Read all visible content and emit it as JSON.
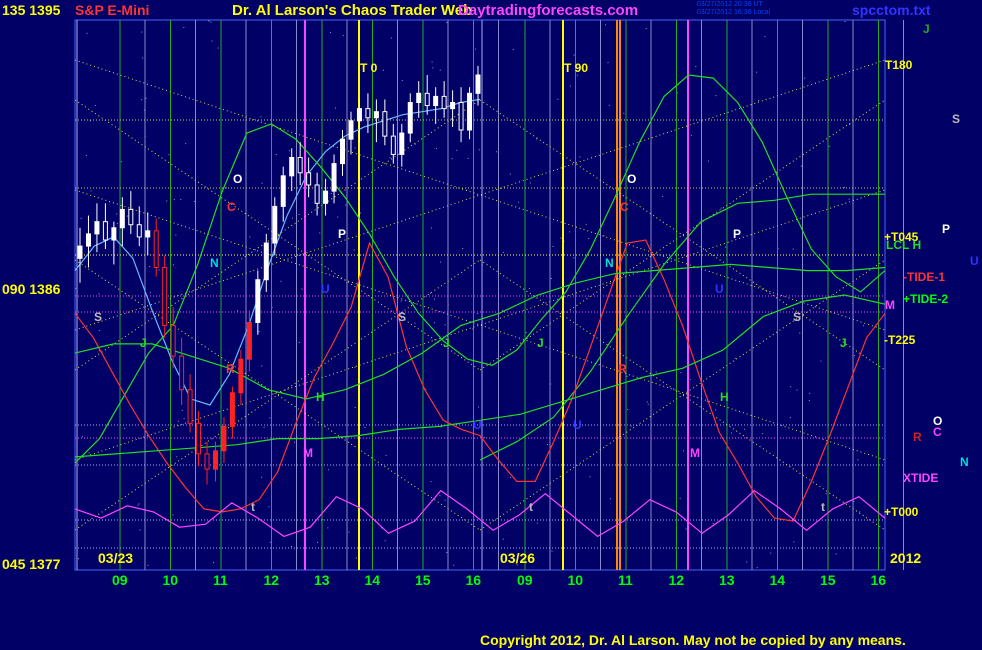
{
  "header": {
    "left_top": "135 1395",
    "instrument": "S&P E-Mini",
    "title": "Dr. Al Larson's Chaos Trader Web",
    "site": "Daytradingforecasts.com",
    "timestamp_1": "03/27/2012 20:36 UT",
    "timestamp_2": "03/27/2012 16:36 Local",
    "file": "spcctom.txt"
  },
  "axis": {
    "left_mid": "090 1386",
    "left_bottom": "045 1377",
    "date_left": "03/23",
    "date_right": "03/26",
    "year": "2012",
    "hours": [
      "09",
      "10",
      "11",
      "12",
      "13",
      "14",
      "15",
      "16",
      "09",
      "10",
      "11",
      "12",
      "13",
      "14",
      "15",
      "16"
    ]
  },
  "right_labels": {
    "j": "J",
    "t180": "T180",
    "s": "S",
    "p": "P",
    "t045": "+T045",
    "lcl_h": "LCL H",
    "tide1": "-TIDE-1",
    "tide2": "+TIDE-2",
    "m": "M",
    "t225": "-T225",
    "o": "O",
    "r": "R",
    "c": "C",
    "n": "N",
    "xtide": "XTIDE",
    "t000": "+T000",
    "u": "U"
  },
  "plot_markers": {
    "t0": "T 0",
    "t90": "T 90",
    "o": "O",
    "c": "C",
    "p": "P",
    "n": "N",
    "u": "U",
    "s": "S",
    "j": "J",
    "h": "H",
    "m": "M",
    "r": "R",
    "t": "t"
  },
  "copyright": "Copyright 2012, Dr. Al Larson. May not be copied by any means.",
  "colors": {
    "background": "#000066",
    "price_text": "#ffff00",
    "instrument": "#ff3333",
    "site": "#ff44ff",
    "file": "#3333ff",
    "hour_labels": "#00ff00",
    "tide1": "#ff3333",
    "tide2": "#00ff00",
    "xtide": "#ff44ff"
  },
  "chart_data": {
    "type": "line",
    "ylim": [
      1377,
      1395
    ],
    "y_ticks": [
      1377,
      1386,
      1395
    ],
    "sessions": [
      "03/23",
      "03/26"
    ],
    "price_bars": [
      {
        "o": 1387.2,
        "h": 1388.2,
        "l": 1386.4,
        "c": 1387.6
      },
      {
        "o": 1387.6,
        "h": 1388.6,
        "l": 1386.9,
        "c": 1388.0
      },
      {
        "o": 1388.0,
        "h": 1389.0,
        "l": 1387.4,
        "c": 1388.4
      },
      {
        "o": 1388.4,
        "h": 1389.0,
        "l": 1387.5,
        "c": 1387.8
      },
      {
        "o": 1387.8,
        "h": 1388.4,
        "l": 1387.0,
        "c": 1388.2
      },
      {
        "o": 1388.2,
        "h": 1389.2,
        "l": 1387.6,
        "c": 1388.8
      },
      {
        "o": 1388.8,
        "h": 1389.4,
        "l": 1388.0,
        "c": 1388.3
      },
      {
        "o": 1388.3,
        "h": 1388.9,
        "l": 1387.6,
        "c": 1387.9
      },
      {
        "o": 1387.9,
        "h": 1388.7,
        "l": 1387.3,
        "c": 1388.1
      },
      {
        "o": 1388.1,
        "h": 1388.5,
        "l": 1386.6,
        "c": 1386.9
      },
      {
        "o": 1386.9,
        "h": 1387.3,
        "l": 1384.6,
        "c": 1385.0
      },
      {
        "o": 1385.0,
        "h": 1385.6,
        "l": 1383.6,
        "c": 1384.0
      },
      {
        "o": 1384.0,
        "h": 1384.6,
        "l": 1382.4,
        "c": 1382.9
      },
      {
        "o": 1382.9,
        "h": 1383.4,
        "l": 1381.5,
        "c": 1381.8
      },
      {
        "o": 1381.8,
        "h": 1382.2,
        "l": 1380.4,
        "c": 1380.8
      },
      {
        "o": 1380.8,
        "h": 1381.2,
        "l": 1379.8,
        "c": 1380.3
      },
      {
        "o": 1380.3,
        "h": 1381.2,
        "l": 1379.9,
        "c": 1380.9
      },
      {
        "o": 1380.9,
        "h": 1382.0,
        "l": 1380.5,
        "c": 1381.7
      },
      {
        "o": 1381.7,
        "h": 1383.0,
        "l": 1381.3,
        "c": 1382.8
      },
      {
        "o": 1382.8,
        "h": 1384.2,
        "l": 1382.4,
        "c": 1383.9
      },
      {
        "o": 1383.9,
        "h": 1385.5,
        "l": 1383.5,
        "c": 1385.1
      },
      {
        "o": 1385.1,
        "h": 1386.8,
        "l": 1384.7,
        "c": 1386.5
      },
      {
        "o": 1386.5,
        "h": 1388.0,
        "l": 1386.1,
        "c": 1387.7
      },
      {
        "o": 1387.7,
        "h": 1389.2,
        "l": 1387.3,
        "c": 1388.9
      },
      {
        "o": 1388.9,
        "h": 1390.2,
        "l": 1388.4,
        "c": 1389.9
      },
      {
        "o": 1389.9,
        "h": 1390.8,
        "l": 1389.4,
        "c": 1390.5
      },
      {
        "o": 1390.5,
        "h": 1391.0,
        "l": 1389.6,
        "c": 1390.0
      },
      {
        "o": 1390.0,
        "h": 1390.5,
        "l": 1389.2,
        "c": 1389.6
      },
      {
        "o": 1389.6,
        "h": 1390.0,
        "l": 1388.6,
        "c": 1389.0
      },
      {
        "o": 1389.0,
        "h": 1389.8,
        "l": 1388.6,
        "c": 1389.4
      },
      {
        "o": 1389.4,
        "h": 1390.6,
        "l": 1389.0,
        "c": 1390.3
      },
      {
        "o": 1390.3,
        "h": 1391.4,
        "l": 1389.9,
        "c": 1391.1
      },
      {
        "o": 1391.1,
        "h": 1392.0,
        "l": 1390.6,
        "c": 1391.7
      },
      {
        "o": 1391.7,
        "h": 1392.4,
        "l": 1391.0,
        "c": 1392.1
      },
      {
        "o": 1392.1,
        "h": 1392.6,
        "l": 1391.3,
        "c": 1391.8
      },
      {
        "o": 1391.8,
        "h": 1392.4,
        "l": 1391.0,
        "c": 1392.0
      },
      {
        "o": 1392.0,
        "h": 1392.4,
        "l": 1390.9,
        "c": 1391.2
      },
      {
        "o": 1391.2,
        "h": 1391.6,
        "l": 1390.3,
        "c": 1390.6
      },
      {
        "o": 1390.6,
        "h": 1391.6,
        "l": 1390.2,
        "c": 1391.3
      },
      {
        "o": 1391.3,
        "h": 1392.6,
        "l": 1391.0,
        "c": 1392.3
      },
      {
        "o": 1392.3,
        "h": 1393.0,
        "l": 1391.8,
        "c": 1392.6
      },
      {
        "o": 1392.6,
        "h": 1393.2,
        "l": 1391.9,
        "c": 1392.2
      },
      {
        "o": 1392.2,
        "h": 1392.8,
        "l": 1391.6,
        "c": 1392.5
      },
      {
        "o": 1392.5,
        "h": 1393.0,
        "l": 1391.8,
        "c": 1392.1
      },
      {
        "o": 1392.1,
        "h": 1392.7,
        "l": 1391.5,
        "c": 1392.3
      },
      {
        "o": 1392.3,
        "h": 1392.8,
        "l": 1391.0,
        "c": 1391.4
      },
      {
        "o": 1391.4,
        "h": 1392.8,
        "l": 1391.1,
        "c": 1392.6
      },
      {
        "o": 1392.6,
        "h": 1393.5,
        "l": 1392.2,
        "c": 1393.2
      }
    ],
    "series": [
      {
        "values": [
          1386.8,
          1387.6,
          1387.9,
          1387.2,
          1385.5,
          1383.9,
          1382.6,
          1382.4,
          1383.4,
          1385.0,
          1386.9,
          1388.6,
          1389.9,
          1390.7,
          1391.2,
          1391.5,
          1391.7,
          1391.9,
          1392.0,
          1392.1,
          1392.3,
          1392.4
        ]
      },
      {
        "values": [
          1380.6,
          1381.2,
          1382.0,
          1383.5,
          1385.3,
          1387.0,
          1388.4,
          1389.0,
          1389.1,
          1389.3,
          1389.3,
          1389.3
        ]
      },
      {
        "values": [
          1380.5,
          1381.3,
          1382.7,
          1384.1,
          1385.0,
          1387.0,
          1389.4,
          1391.3,
          1391.6,
          1391.1,
          1390.2,
          1389.2,
          1388.0,
          1386.6,
          1385.4,
          1384.5,
          1383.9,
          1383.7,
          1384.2,
          1385.2,
          1386.1,
          1387.5,
          1389.2,
          1391.0,
          1392.5,
          1393.2,
          1393.1,
          1392.3,
          1391.0,
          1389.2,
          1387.5,
          1386.6,
          1386.1,
          1386.8
        ]
      },
      {
        "values": [
          1385.4,
          1384.6,
          1383.5,
          1382.4,
          1381.4,
          1380.5,
          1379.7,
          1379.0,
          1378.9,
          1379.0,
          1379.3,
          1380.2,
          1381.8,
          1383.3,
          1384.4,
          1385.6,
          1387.7,
          1386.6,
          1384.3,
          1382.9,
          1381.9,
          1381.6,
          1381.4,
          1380.6,
          1379.9,
          1379.9,
          1381.2,
          1382.6,
          1384.3,
          1386.0,
          1387.7,
          1387.8,
          1386.5,
          1385.0,
          1383.2,
          1381.5,
          1380.5,
          1379.4,
          1378.7,
          1378.6,
          1379.9,
          1381.4,
          1383.0,
          1384.6,
          1385.4
        ]
      },
      {
        "values": [
          1384.1,
          1384.4,
          1384.4,
          1384.0,
          1383.6,
          1382.9,
          1382.6,
          1382.9,
          1383.4,
          1384.1,
          1385.0,
          1385.4,
          1386.0,
          1386.4,
          1386.7,
          1386.8,
          1386.9,
          1387.0,
          1386.9,
          1386.8,
          1386.8,
          1386.9
        ]
      },
      {
        "values": [
          1380.7,
          1380.8,
          1380.9,
          1381.0,
          1381.1,
          1381.3,
          1381.3,
          1381.4,
          1381.6,
          1381.7,
          1381.9,
          1382.1,
          1382.5,
          1382.9,
          1383.3,
          1383.6,
          1384.2,
          1385.3,
          1385.8,
          1386.0,
          1385.7
        ]
      },
      {
        "values": [
          1379.0,
          1378.7,
          1379.1,
          1378.9,
          1378.4,
          1378.5,
          1379.2,
          1378.7,
          1378.1,
          1378.4,
          1379.4,
          1379.0,
          1378.2,
          1378.6,
          1379.6,
          1379.0,
          1378.3,
          1378.8,
          1379.5,
          1378.8,
          1378.1,
          1378.6,
          1379.3,
          1378.9,
          1378.2,
          1378.8,
          1379.6,
          1379.0,
          1378.3,
          1379.0,
          1379.4,
          1378.7
        ]
      }
    ]
  }
}
